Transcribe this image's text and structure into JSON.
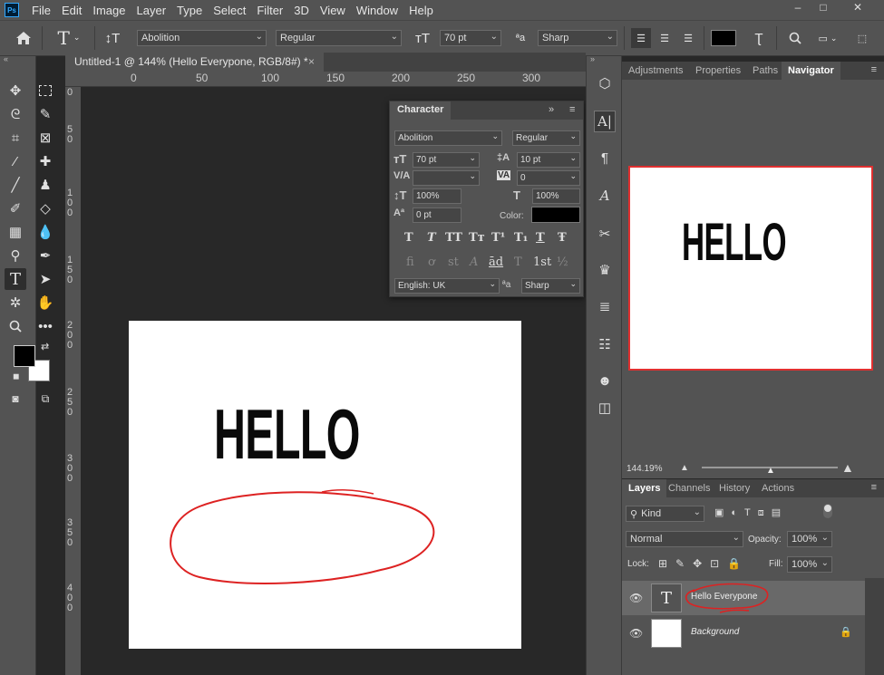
{
  "menubar": {
    "logo": "Ps",
    "items": [
      "File",
      "Edit",
      "Image",
      "Layer",
      "Type",
      "Select",
      "Filter",
      "3D",
      "View",
      "Window",
      "Help"
    ],
    "window_controls": [
      "–",
      "□",
      "✕"
    ]
  },
  "options_bar": {
    "font_family": "Abolition",
    "font_style": "Regular",
    "font_size": "70 pt",
    "aa_label": "ªa",
    "anti_alias": "Sharp"
  },
  "document": {
    "tab_title": "Untitled-1 @ 144% (Hello  Everypone, RGB/8#) *",
    "tab_close": "×",
    "ruler_h": [
      "0",
      "50",
      "100",
      "150",
      "200",
      "250",
      "300"
    ],
    "ruler_v": [
      [
        "0"
      ],
      [
        "5",
        "0"
      ],
      [
        "1",
        "0",
        "0"
      ],
      [
        "1",
        "5",
        "0"
      ],
      [
        "2",
        "0",
        "0"
      ],
      [
        "2",
        "5",
        "0"
      ],
      [
        "3",
        "0",
        "0"
      ],
      [
        "3",
        "5",
        "0"
      ],
      [
        "4",
        "0",
        "0"
      ]
    ],
    "canvas_text": "HELLO"
  },
  "character_panel": {
    "title": "Character",
    "collapse": "»",
    "font_family": "Abolition",
    "font_style": "Regular",
    "size": "70 pt",
    "leading": "10 pt",
    "kerning": "",
    "tracking": "0",
    "vscale": "100%",
    "hscale": "100%",
    "baseline": "0 pt",
    "color_label": "Color:",
    "type_styles": [
      "T",
      "T",
      "TT",
      "Tт",
      "T¹",
      "T₁",
      "T",
      "Ŧ"
    ],
    "opentype": [
      "fi",
      "ơ",
      "st",
      "A",
      "ād",
      "T",
      "1st",
      "½"
    ],
    "language": "English: UK",
    "aa_label": "ªa",
    "anti_alias": "Sharp"
  },
  "right_tabs": {
    "top": [
      "Adjustments",
      "Properties",
      "Paths",
      "Navigator"
    ],
    "bottom": [
      "Layers",
      "Channels",
      "History",
      "Actions"
    ]
  },
  "navigator": {
    "zoom": "144.19%",
    "thumb_text": "HELLO"
  },
  "layers": {
    "kind": "Kind",
    "blend_mode": "Normal",
    "opacity_label": "Opacity:",
    "opacity": "100%",
    "lock_label": "Lock:",
    "fill_label": "Fill:",
    "fill": "100%",
    "items": [
      {
        "name": "Hello  Everypone",
        "thumb": "T"
      },
      {
        "name": "Background"
      }
    ]
  }
}
